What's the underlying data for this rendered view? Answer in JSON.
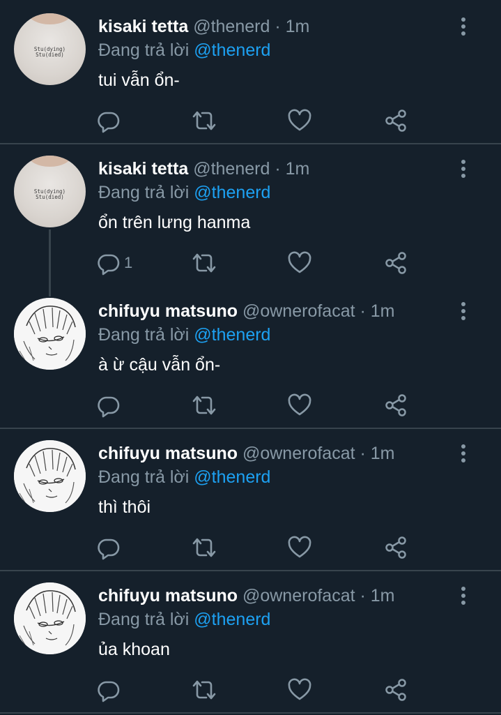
{
  "tweets": [
    {
      "name": "kisaki tetta",
      "handle": "@thenerd",
      "time": "· 1m",
      "replying_prefix": "Đang trả lời",
      "replying_to": "@thenerd",
      "text": "tui vẫn ổn-",
      "reply_count": "",
      "avatar": "shirt",
      "avatar_print": [
        "Stu(dying)",
        "Stu(died)"
      ]
    },
    {
      "name": "kisaki tetta",
      "handle": "@thenerd",
      "time": "· 1m",
      "replying_prefix": "Đang trả lời",
      "replying_to": "@thenerd",
      "text": "ổn trên lưng hanma",
      "reply_count": "1",
      "avatar": "shirt",
      "avatar_print": [
        "Stu(dying)",
        "Stu(died)"
      ]
    },
    {
      "name": "chifuyu matsuno",
      "handle": "@ownerofacat",
      "time": "· 1m",
      "replying_prefix": "Đang trả lời",
      "replying_to": "@thenerd",
      "text": "à ừ cậu vẫn ổn-",
      "reply_count": "",
      "avatar": "manga"
    },
    {
      "name": "chifuyu matsuno",
      "handle": "@ownerofacat",
      "time": "· 1m",
      "replying_prefix": "Đang trả lời",
      "replying_to": "@thenerd",
      "text": "thì thôi",
      "reply_count": "",
      "avatar": "manga"
    },
    {
      "name": "chifuyu matsuno",
      "handle": "@ownerofacat",
      "time": "· 1m",
      "replying_prefix": "Đang trả lời",
      "replying_to": "@thenerd",
      "text": "ủa khoan",
      "reply_count": "",
      "avatar": "manga"
    }
  ],
  "icons": {
    "reply": "reply-icon",
    "retweet": "retweet-icon",
    "like": "heart-icon",
    "share": "share-icon",
    "more": "more-vertical-icon"
  },
  "colors": {
    "background": "#15202b",
    "divider": "#38444d",
    "secondary_text": "#8899a6",
    "mention": "#1da1f2",
    "primary_text": "#ffffff"
  }
}
